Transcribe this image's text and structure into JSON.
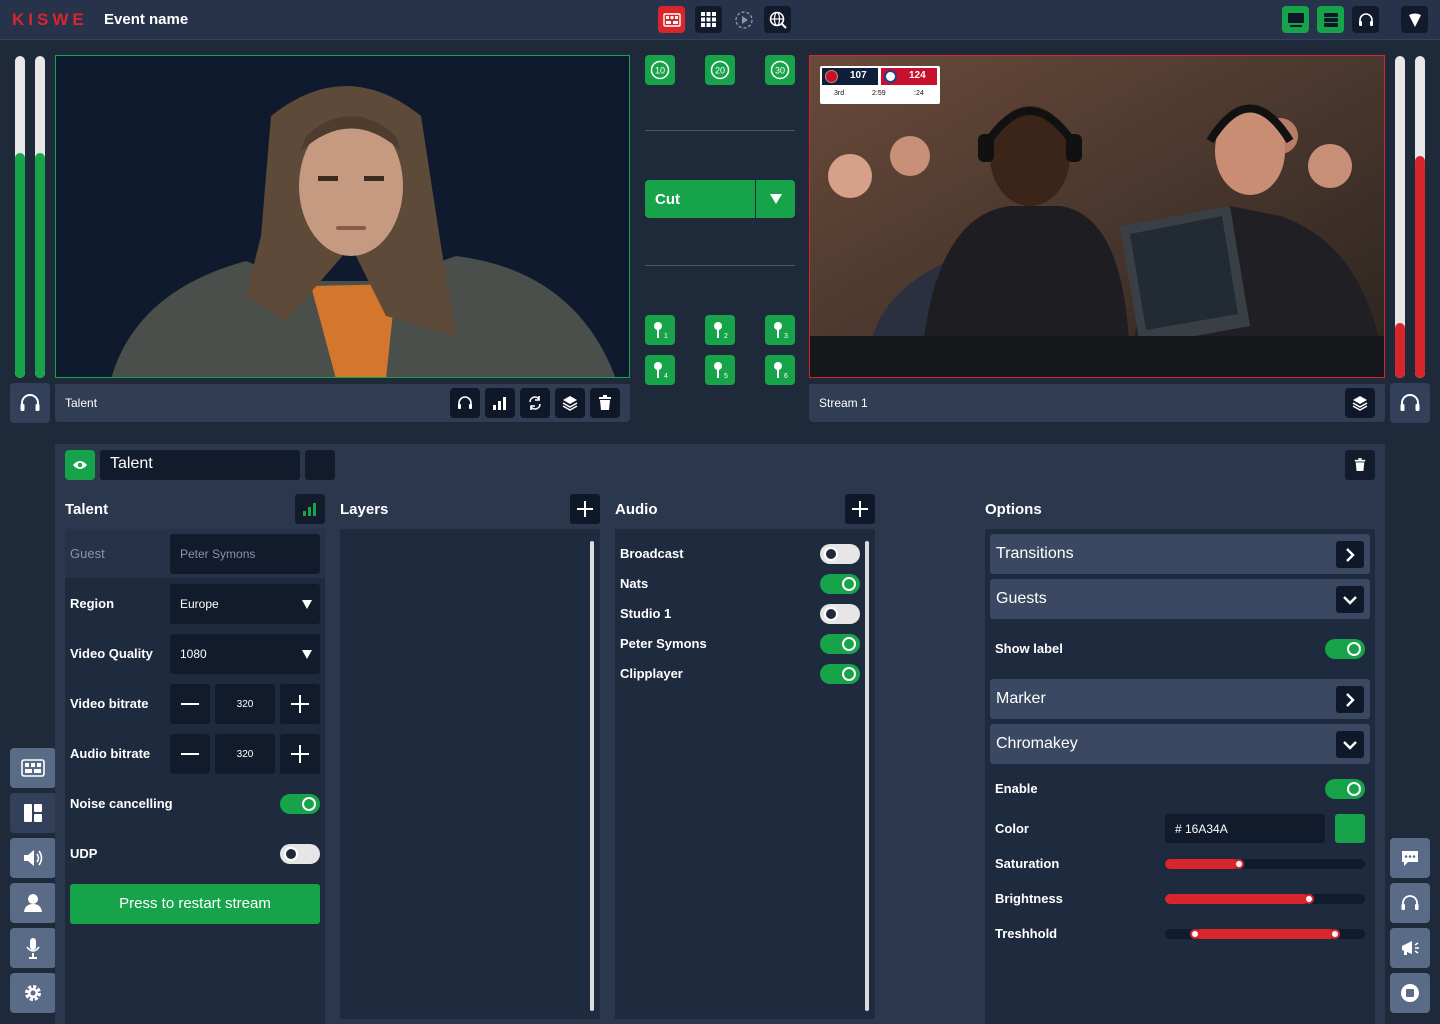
{
  "app": {
    "logo": "KISWE",
    "event_name": "Event name"
  },
  "topbar": {
    "center_icons": [
      "multiview-icon",
      "grid-icon",
      "replay-icon",
      "globe-search-icon"
    ],
    "right_icons": [
      "monitor-icon",
      "server-icon",
      "headset-icon",
      "shield-icon"
    ]
  },
  "meters": {
    "left_level_1": 0.7,
    "left_level_2": 0.7,
    "right_level_1": 0.17,
    "right_level_2": 0.69
  },
  "preview": {
    "label": "Talent",
    "border": "#16a34a",
    "image": "person with long dreadlocks against dark background",
    "icons": [
      "headset-icon",
      "signal-bars-icon",
      "refresh-icon",
      "layers-icon",
      "trash-icon"
    ]
  },
  "program": {
    "label": "Stream 1",
    "border": "#d9262c",
    "icons": [
      "layers-icon"
    ]
  },
  "scorebug": {
    "home_score": "107",
    "away_score": "124",
    "period": "3rd",
    "clock": "2:59",
    "shot_clock": ":24"
  },
  "switcher": {
    "replay_buttons": [
      "10",
      "20",
      "30"
    ],
    "cut_label": "Cut",
    "markers": [
      "1",
      "2",
      "3",
      "4",
      "5",
      "6"
    ]
  },
  "source": {
    "name": "Talent"
  },
  "talent": {
    "title": "Talent",
    "guest_label": "Guest",
    "guest_value": "Peter Symons",
    "region_label": "Region",
    "region_value": "Europe",
    "quality_label": "Video Quality",
    "quality_value": "1080",
    "vbitrate_label": "Video bitrate",
    "vbitrate_value": "320",
    "abitrate_label": "Audio bitrate",
    "abitrate_value": "320",
    "noise_label": "Noise cancelling",
    "noise_on": true,
    "udp_label": "UDP",
    "udp_on": false,
    "restart_label": "Press to restart stream"
  },
  "layers": {
    "title": "Layers"
  },
  "audio": {
    "title": "Audio",
    "items": [
      {
        "label": "Broadcast",
        "on": false
      },
      {
        "label": "Nats",
        "on": true
      },
      {
        "label": "Studio 1",
        "on": false
      },
      {
        "label": "Peter Symons",
        "on": true
      },
      {
        "label": "Clipplayer",
        "on": true
      }
    ]
  },
  "options": {
    "title": "Options",
    "transitions": "Transitions",
    "guests": "Guests",
    "show_label": "Show label",
    "show_label_on": true,
    "marker": "Marker",
    "chromakey": "Chromakey",
    "enable": "Enable",
    "enable_on": true,
    "color_label": "Color",
    "color_value": "# 16A34A",
    "color_swatch": "#16A34A",
    "saturation_label": "Saturation",
    "saturation": 0.37,
    "brightness_label": "Brightness",
    "brightness": 0.72,
    "threshold_label": "Treshhold",
    "threshold_low": 0.15,
    "threshold_high": 0.85
  },
  "sidebar_left": [
    "multiview-icon",
    "layout-icon",
    "speaker-icon",
    "user-icon",
    "microphone-icon",
    "gear-icon"
  ],
  "sidebar_right": [
    "chat-icon",
    "headset-icon",
    "megaphone-icon",
    "stop-icon"
  ]
}
